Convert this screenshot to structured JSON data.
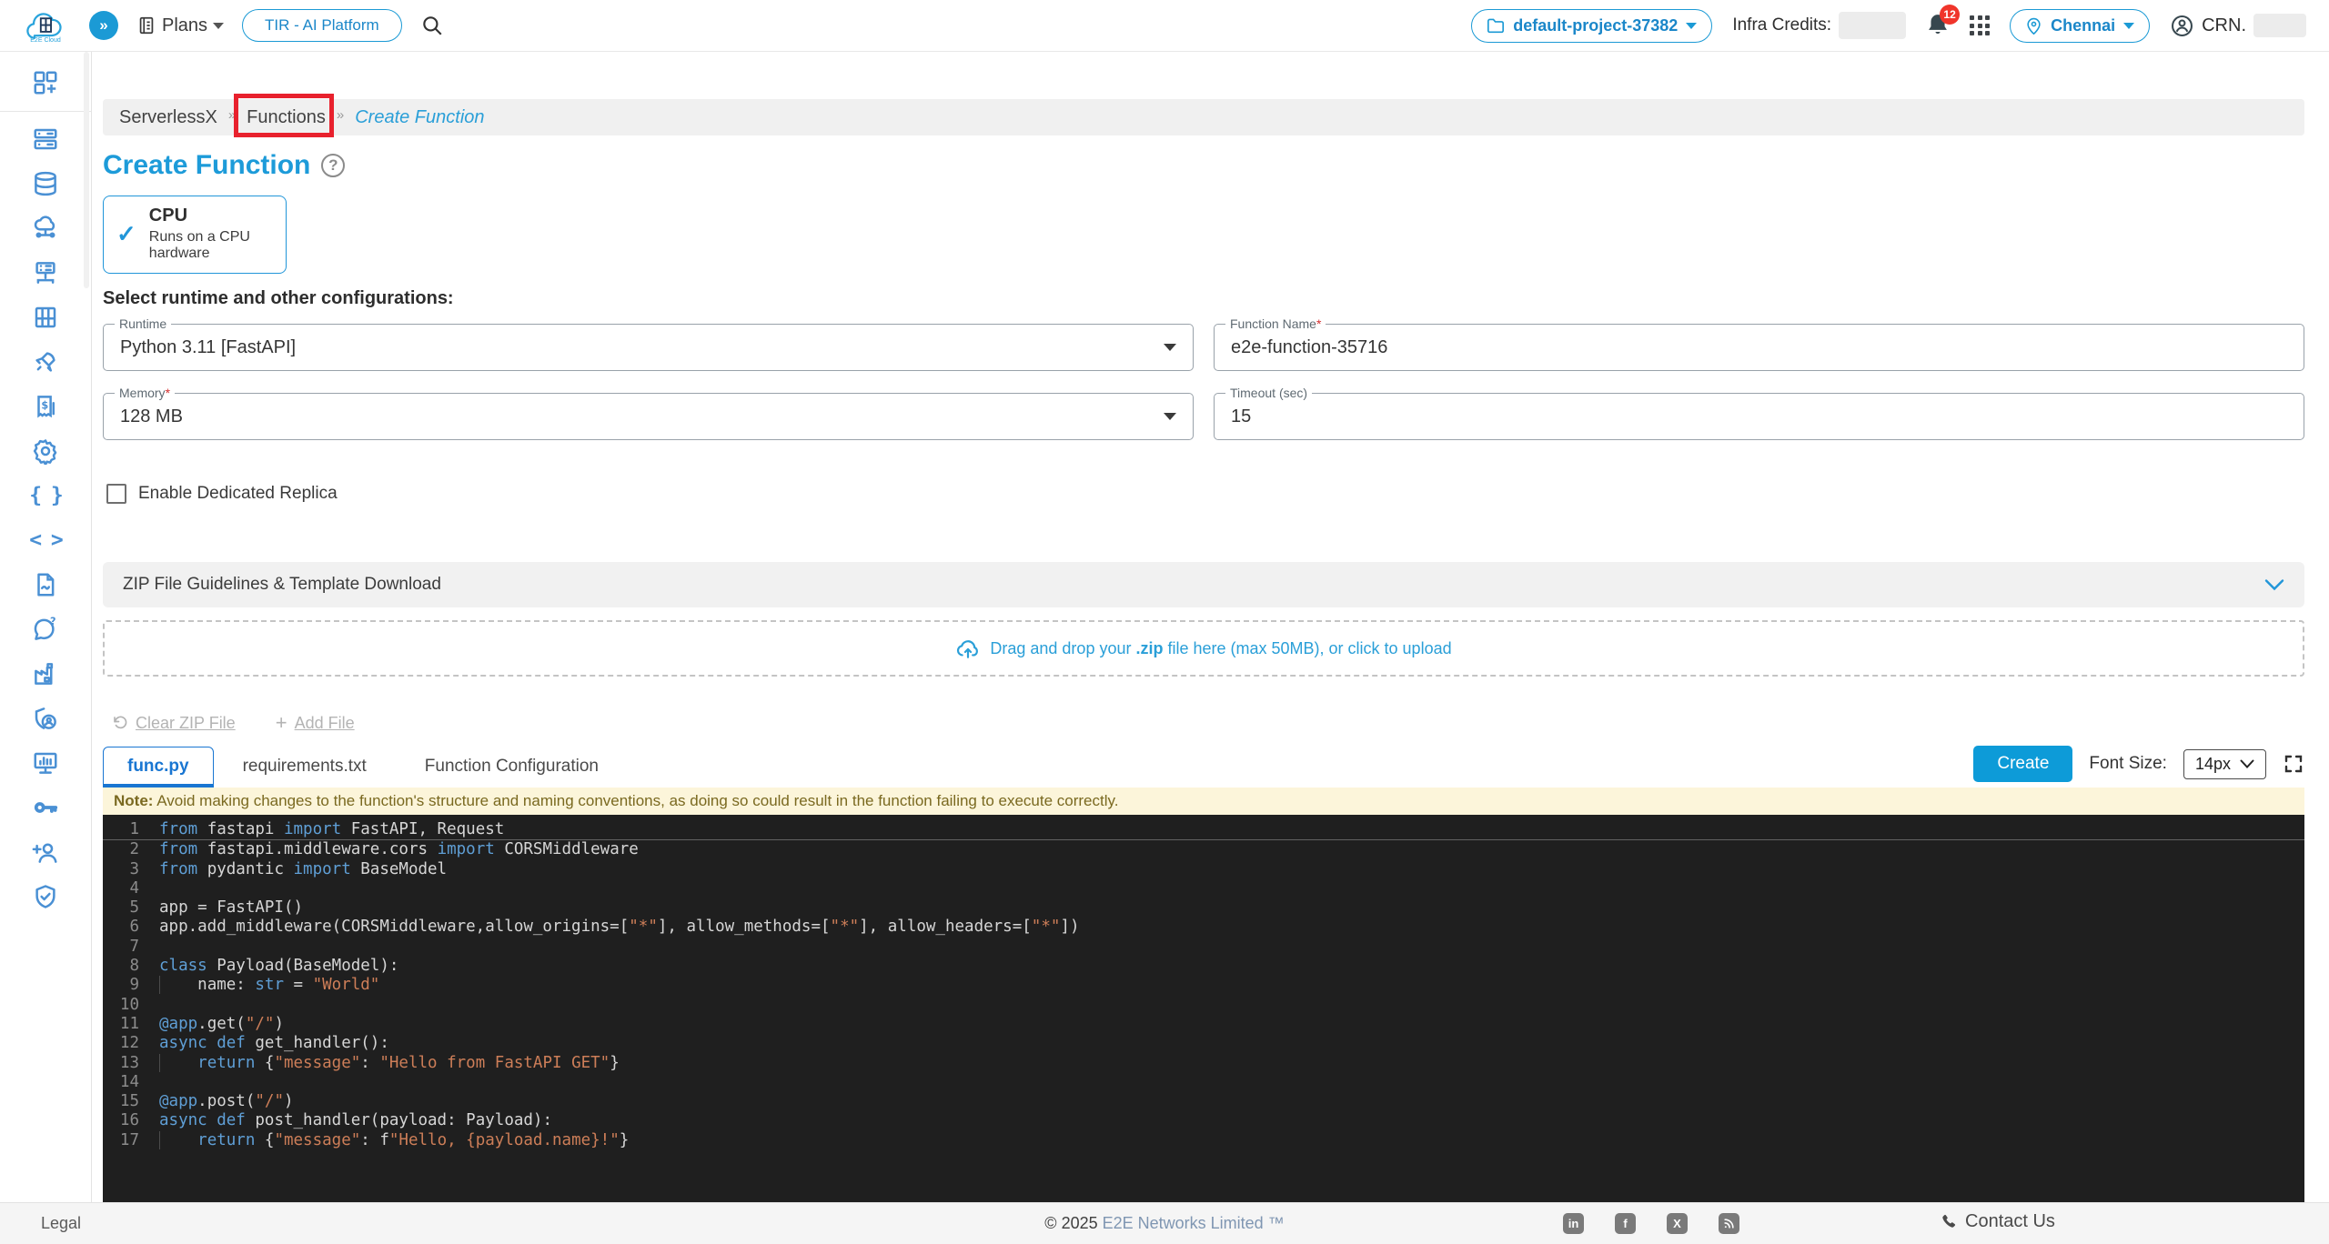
{
  "colors": {
    "accent_blue": "#1b9ad5",
    "title_blue": "#1d9bd9",
    "tab_active_blue": "#1976d2",
    "create_button": "#0d9bd8",
    "annotation_red": "#e8212d",
    "note_bg": "#fcf5da",
    "note_text": "#7a6920",
    "editor_bg": "#1f1f1f",
    "code_keyword": "#5f9fd6",
    "code_string": "#cd7e58",
    "badge_red": "#f0352b"
  },
  "header": {
    "logo": "E2E Cloud",
    "collapse_glyph": "»",
    "plans": "Plans",
    "platform_pill": "TIR - AI Platform",
    "project": "default-project-37382",
    "infra_credits_label": "Infra Credits:",
    "notification_badge": "12",
    "region": "Chennai",
    "crn_label": "CRN."
  },
  "sidebar": {
    "icons": [
      "dashboard-add",
      "compute-nodes",
      "database",
      "cloud-network",
      "server-network",
      "container-registry",
      "rocket",
      "billing",
      "settings",
      "curly-braces",
      "code-brackets",
      "document",
      "support-chat",
      "factory",
      "shield-user",
      "monitoring",
      "api-key",
      "add-user",
      "security-shield"
    ]
  },
  "breadcrumb": {
    "sep": "»",
    "items": [
      "ServerlessX",
      "Functions",
      "Create Function"
    ]
  },
  "page": {
    "title": "Create Function"
  },
  "hardware_card": {
    "title": "CPU",
    "subtitle": "Runs on a CPU hardware",
    "check_glyph": "✓"
  },
  "form": {
    "section_label": "Select runtime and other configurations:",
    "runtime": {
      "label": "Runtime",
      "value": "Python 3.11 [FastAPI]"
    },
    "function_name": {
      "label": "Function Name",
      "required": "*",
      "value": "e2e-function-35716"
    },
    "memory": {
      "label": "Memory",
      "required": "*",
      "value": "128 MB"
    },
    "timeout": {
      "label": "Timeout (sec)",
      "value": "15"
    },
    "replica_checkbox_label": "Enable Dedicated Replica"
  },
  "upload": {
    "accordion_label": "ZIP File Guidelines & Template Download",
    "dropzone_pre": "Drag and drop your ",
    "dropzone_bold": ".zip",
    "dropzone_post": " file here (max 50MB), or click to upload",
    "clear_zip": "Clear ZIP File",
    "add_file_plus": "+",
    "add_file": "Add File"
  },
  "editor": {
    "tabs": [
      "func.py",
      "requirements.txt",
      "Function Configuration"
    ],
    "active_tab": "func.py",
    "create_button": "Create",
    "font_size_label": "Font Size:",
    "font_size_value": "14px",
    "note_label": "Note:",
    "note_text": " Avoid making changes to the function's structure and naming conventions, as doing so could result in the function failing to execute correctly.",
    "code": {
      "language": "python",
      "lines": [
        [
          {
            "c": "k",
            "s": "from"
          },
          {
            "c": "p",
            "s": " fastapi "
          },
          {
            "c": "k",
            "s": "import"
          },
          {
            "c": "p",
            "s": " FastAPI, Request"
          }
        ],
        [
          {
            "c": "k",
            "s": "from"
          },
          {
            "c": "p",
            "s": " fastapi.middleware.cors "
          },
          {
            "c": "k",
            "s": "import"
          },
          {
            "c": "p",
            "s": " CORSMiddleware"
          }
        ],
        [
          {
            "c": "k",
            "s": "from"
          },
          {
            "c": "p",
            "s": " pydantic "
          },
          {
            "c": "k",
            "s": "import"
          },
          {
            "c": "p",
            "s": " BaseModel"
          }
        ],
        [],
        [
          {
            "c": "p",
            "s": "app = FastAPI()"
          }
        ],
        [
          {
            "c": "p",
            "s": "app.add_middleware(CORSMiddleware,allow_origins=["
          },
          {
            "c": "s",
            "s": "\"*\""
          },
          {
            "c": "p",
            "s": "], allow_methods=["
          },
          {
            "c": "s",
            "s": "\"*\""
          },
          {
            "c": "p",
            "s": "], allow_headers=["
          },
          {
            "c": "s",
            "s": "\"*\""
          },
          {
            "c": "p",
            "s": "])"
          }
        ],
        [],
        [
          {
            "c": "k",
            "s": "class"
          },
          {
            "c": "p",
            "s": " Payload(BaseModel):"
          }
        ],
        [
          {
            "c": "i",
            "s": "    "
          },
          {
            "c": "p",
            "s": "name: "
          },
          {
            "c": "k",
            "s": "str"
          },
          {
            "c": "p",
            "s": " = "
          },
          {
            "c": "s",
            "s": "\"World\""
          }
        ],
        [],
        [
          {
            "c": "k",
            "s": "@app"
          },
          {
            "c": "p",
            "s": ".get("
          },
          {
            "c": "s",
            "s": "\"/\""
          },
          {
            "c": "p",
            "s": ")"
          }
        ],
        [
          {
            "c": "k",
            "s": "async"
          },
          {
            "c": "p",
            "s": " "
          },
          {
            "c": "k",
            "s": "def"
          },
          {
            "c": "p",
            "s": " get_handler():"
          }
        ],
        [
          {
            "c": "i",
            "s": "    "
          },
          {
            "c": "k",
            "s": "return"
          },
          {
            "c": "p",
            "s": " {"
          },
          {
            "c": "s",
            "s": "\"message\""
          },
          {
            "c": "p",
            "s": ": "
          },
          {
            "c": "s",
            "s": "\"Hello from FastAPI GET\""
          },
          {
            "c": "p",
            "s": "}"
          }
        ],
        [],
        [
          {
            "c": "k",
            "s": "@app"
          },
          {
            "c": "p",
            "s": ".post("
          },
          {
            "c": "s",
            "s": "\"/\""
          },
          {
            "c": "p",
            "s": ")"
          }
        ],
        [
          {
            "c": "k",
            "s": "async"
          },
          {
            "c": "p",
            "s": " "
          },
          {
            "c": "k",
            "s": "def"
          },
          {
            "c": "p",
            "s": " post_handler(payload: Payload):"
          }
        ],
        [
          {
            "c": "i",
            "s": "    "
          },
          {
            "c": "k",
            "s": "return"
          },
          {
            "c": "p",
            "s": " {"
          },
          {
            "c": "s",
            "s": "\"message\""
          },
          {
            "c": "p",
            "s": ": f"
          },
          {
            "c": "s",
            "s": "\"Hello, {payload.name}!\""
          },
          {
            "c": "p",
            "s": "}"
          }
        ]
      ]
    }
  },
  "footer": {
    "legal": "Legal",
    "copyright_prefix": "© 2025 ",
    "copyright_brand": "E2E Networks Limited ™",
    "contact": "Contact Us"
  }
}
